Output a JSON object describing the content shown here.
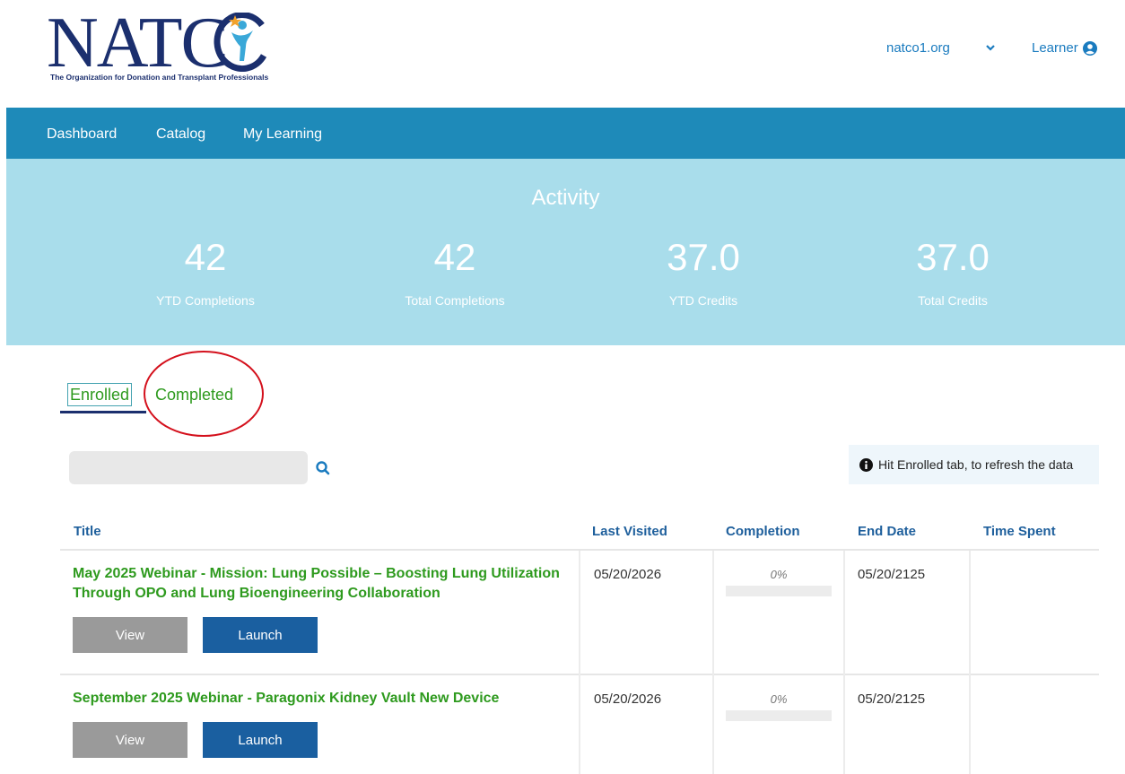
{
  "brand": {
    "logo_text": "NATCO",
    "tagline": "The Organization for Donation and Transplant Professionals",
    "colors": {
      "navy": "#1b2f6e",
      "nav_blue": "#1e8ab9",
      "activity_bg": "#a9ddeb",
      "title_green": "#2e9a1e"
    }
  },
  "header": {
    "site_link": "natco1.org",
    "site_chevron_icon": "chevron-down-icon",
    "learner_label": "Learner",
    "learner_icon": "user-circle-icon"
  },
  "nav": {
    "items": [
      {
        "label": "Dashboard"
      },
      {
        "label": "Catalog"
      },
      {
        "label": "My Learning"
      }
    ]
  },
  "activity": {
    "title": "Activity",
    "stats": [
      {
        "value": "42",
        "label": "YTD Completions"
      },
      {
        "value": "42",
        "label": "Total Completions"
      },
      {
        "value": "37.0",
        "label": "YTD Credits"
      },
      {
        "value": "37.0",
        "label": "Total Credits"
      }
    ]
  },
  "tabs": {
    "enrolled": "Enrolled",
    "completed": "Completed",
    "active": "Enrolled"
  },
  "search": {
    "value": "",
    "placeholder": "",
    "icon": "search-icon"
  },
  "info": {
    "icon": "info-circle-icon",
    "text": "Hit Enrolled tab, to refresh the data"
  },
  "table": {
    "headers": {
      "title": "Title",
      "last_visited": "Last Visited",
      "completion": "Completion",
      "end_date": "End Date",
      "time_spent": "Time Spent"
    },
    "rows": [
      {
        "title": "May 2025 Webinar - Mission: Lung Possible – Boosting Lung Utilization Through OPO and Lung Bioengineering Collaboration",
        "last_visited": "05/20/2026",
        "completion_text": "0%",
        "completion": 0,
        "end_date": "05/20/2125",
        "time_spent": "",
        "view_label": "View",
        "launch_label": "Launch"
      },
      {
        "title": "September 2025 Webinar - Paragonix Kidney Vault New Device",
        "last_visited": "05/20/2026",
        "completion_text": "0%",
        "completion": 0,
        "end_date": "05/20/2125",
        "time_spent": "",
        "view_label": "View",
        "launch_label": "Launch"
      }
    ]
  }
}
